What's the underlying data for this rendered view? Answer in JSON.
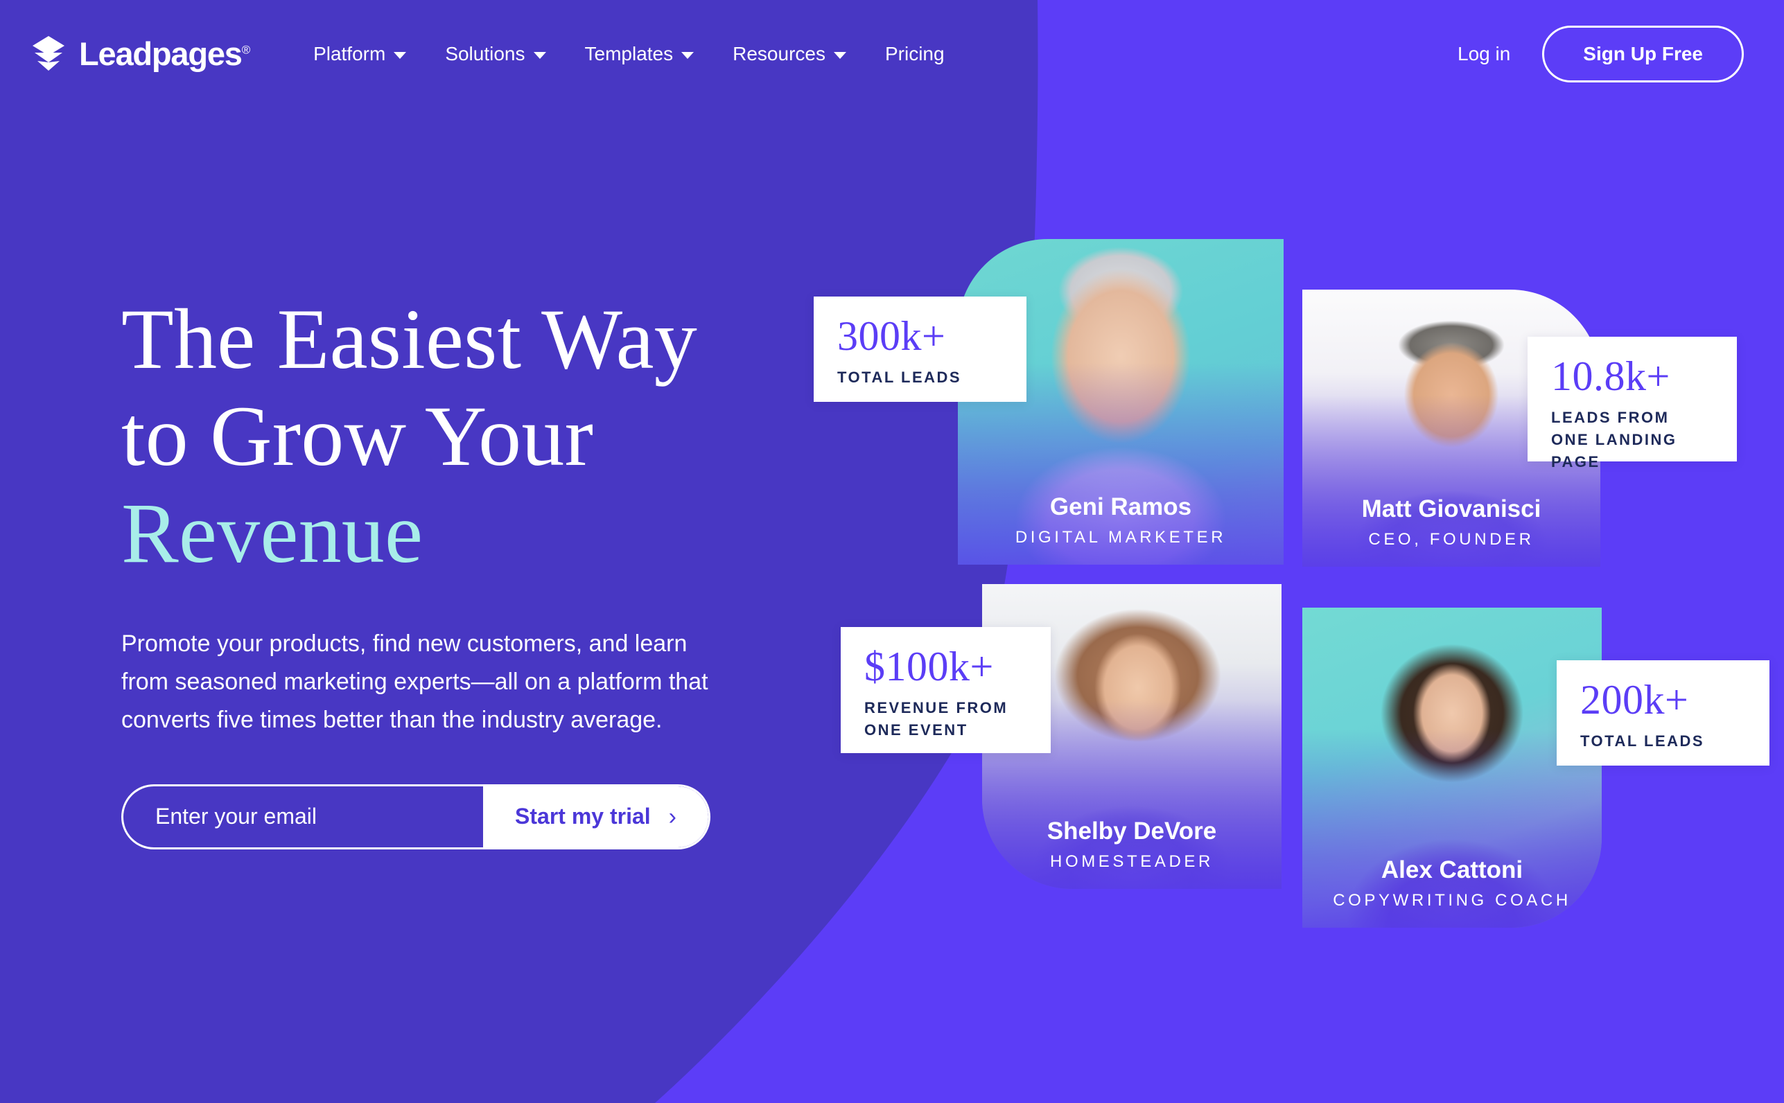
{
  "brand": {
    "name": "Leadpages",
    "registered_mark": "®",
    "logo_icon": "stacked-layers-icon",
    "accent_purple": "#5B3DF6",
    "bg_purple_bright": "#5C3DF7",
    "bg_purple_dark": "#4837C3",
    "accent_aqua": "#A8EDE9",
    "stat_label_navy": "#1E2A5A"
  },
  "header": {
    "nav": [
      {
        "label": "Platform",
        "has_caret": true,
        "icon": "chevron-down-icon"
      },
      {
        "label": "Solutions",
        "has_caret": true,
        "icon": "chevron-down-icon"
      },
      {
        "label": "Templates",
        "has_caret": true,
        "icon": "chevron-down-icon"
      },
      {
        "label": "Resources",
        "has_caret": true,
        "icon": "chevron-down-icon"
      },
      {
        "label": "Pricing",
        "has_caret": false,
        "icon": ""
      }
    ],
    "login_label": "Log in",
    "signup_label": "Sign Up Free"
  },
  "hero": {
    "headline_line1": "The Easiest Way",
    "headline_line2": "to Grow Your",
    "headline_accent": "Revenue",
    "subcopy": "Promote your products, find new customers, and learn from seasoned marketing experts—all on a platform that converts five times better than the industry average.",
    "form": {
      "email_placeholder": "Enter your email",
      "email_value": "",
      "submit_label": "Start my trial",
      "submit_icon": "chevron-right-icon"
    }
  },
  "people": [
    {
      "name": "Geni Ramos",
      "role": "DIGITAL MARKETER",
      "photo_bg": "teal-portrait"
    },
    {
      "name": "Matt Giovanisci",
      "role": "CEO, FOUNDER",
      "photo_bg": "white-portrait"
    },
    {
      "name": "Shelby DeVore",
      "role": "HOMESTEADER",
      "photo_bg": "kitchen-portrait"
    },
    {
      "name": "Alex Cattoni",
      "role": "COPYWRITING COACH",
      "photo_bg": "teal-portrait"
    }
  ],
  "stats": [
    {
      "value": "300k+",
      "label": "TOTAL LEADS"
    },
    {
      "value": "10.8k+",
      "label": "LEADS FROM ONE LANDING PAGE"
    },
    {
      "value": "$100k+",
      "label": "REVENUE FROM ONE EVENT"
    },
    {
      "value": "200k+",
      "label": "TOTAL LEADS"
    }
  ]
}
